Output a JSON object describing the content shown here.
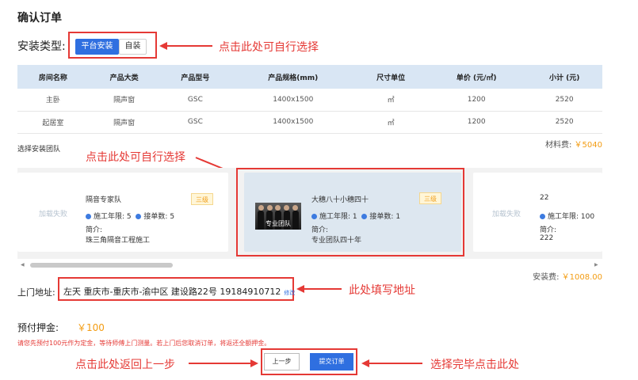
{
  "page": {
    "title": "确认订单",
    "install_type_label": "安装类型:",
    "install_types": [
      "平台安装",
      "自装"
    ],
    "selected_install_type": "平台安装"
  },
  "table": {
    "headers": [
      "房间名称",
      "产品大类",
      "产品型号",
      "产品规格(mm)",
      "尺寸单位",
      "单价 (元/㎡)",
      "小计 (元)"
    ],
    "rows": [
      [
        "主卧",
        "隔声窗",
        "GSC",
        "1400x1500",
        "㎡",
        "1200",
        "2520"
      ],
      [
        "起居室",
        "隔声窗",
        "GSC",
        "1400x1500",
        "㎡",
        "1200",
        "2520"
      ]
    ]
  },
  "material_fee": {
    "label": "材料费:",
    "amount": "￥5040"
  },
  "team_section_label": "选择安装团队",
  "teams": [
    {
      "image_fallback": "加载失败",
      "name": "隔音专家队",
      "level": "三级",
      "years_label": "施工年限:",
      "years": "5",
      "orders_label": "接单数:",
      "orders": "5",
      "intro_label": "简介:",
      "intro": "珠三角隔音工程施工"
    },
    {
      "image_caption": "专业团队",
      "name": "大穗八十小穗四十",
      "level": "三级",
      "years_label": "施工年限:",
      "years": "1",
      "orders_label": "接单数:",
      "orders": "1",
      "intro_label": "简介:",
      "intro": "专业团队四十年"
    },
    {
      "image_fallback": "加载失败",
      "name": "22",
      "years_label": "施工年限:",
      "years": "100",
      "intro_label": "简介:",
      "intro": "222"
    }
  ],
  "install_fee": {
    "label": "安装费:",
    "amount": "￥1008.00"
  },
  "address": {
    "label": "上门地址:",
    "value": "左天 重庆市-重庆市-渝中区 建设路22号 19184910712",
    "edit_label": "修改"
  },
  "deposit": {
    "label": "预付押金:",
    "amount": "￥100",
    "notice": "请您先预付100元作为定金，等待师傅上门测量。若上门后您取消订单，将返还全额押金。"
  },
  "buttons": {
    "prev": "上一步",
    "submit": "提交订单"
  },
  "annotations": {
    "install_type": "点击此处可自行选择",
    "team": "点击此处可自行选择",
    "address": "此处填写地址",
    "prev": "点击此处返回上一步",
    "submit": "选择完毕点击此处"
  },
  "colors": {
    "primary": "#2f6fe0",
    "annotation": "#e53935",
    "price": "#f39c12",
    "header_bg": "#d9e6f4"
  }
}
